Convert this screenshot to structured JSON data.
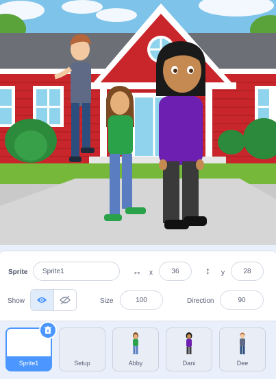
{
  "sprite_info": {
    "sprite_label": "Sprite",
    "sprite_name": "Sprite1",
    "x_label": "x",
    "x_value": "36",
    "y_label": "y",
    "y_value": "28",
    "show_label": "Show",
    "size_label": "Size",
    "size_value": "100",
    "direction_label": "Direction",
    "direction_value": "90"
  },
  "sprites": [
    {
      "name": "Sprite1",
      "selected": true
    },
    {
      "name": "Setup",
      "selected": false
    },
    {
      "name": "Abby",
      "selected": false
    },
    {
      "name": "Dani",
      "selected": false
    },
    {
      "name": "Dee",
      "selected": false
    }
  ],
  "colors": {
    "accent": "#4c97ff",
    "panel_bg": "#e9f0fb"
  }
}
